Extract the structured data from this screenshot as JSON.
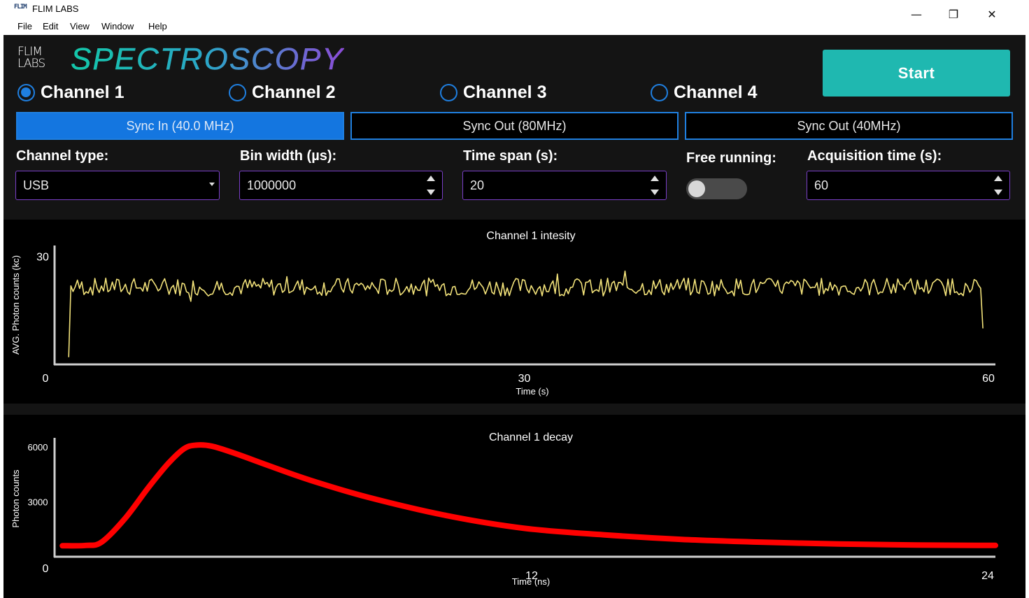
{
  "window": {
    "icon_text": "FLIM",
    "title": "FLIM LABS",
    "minimize": "—",
    "maximize": "❐",
    "close": "✕"
  },
  "menu": [
    "File",
    "Edit",
    "View",
    "Window",
    "Help"
  ],
  "header": {
    "logo_line1": "FLIM",
    "logo_line2": "LABS",
    "brand": "SPECTROSCOPY",
    "start_label": "Start",
    "start_color": "#1fb8b0"
  },
  "channels": [
    {
      "label": "Channel 1",
      "selected": true
    },
    {
      "label": "Channel 2",
      "selected": false
    },
    {
      "label": "Channel 3",
      "selected": false
    },
    {
      "label": "Channel 4",
      "selected": false
    }
  ],
  "sync": [
    {
      "label": "Sync In (40.0 MHz)",
      "active": true
    },
    {
      "label": "Sync Out (80MHz)",
      "active": false
    },
    {
      "label": "Sync Out (40MHz)",
      "active": false
    }
  ],
  "controls": {
    "channel_type_label": "Channel type:",
    "channel_type_value": "USB",
    "bin_width_label": "Bin width (µs):",
    "bin_width_value": "1000000",
    "time_span_label": "Time span (s):",
    "time_span_value": "20",
    "free_running_label": "Free running:",
    "free_running_on": false,
    "acq_time_label": "Acquisition time (s):",
    "acq_time_value": "60"
  },
  "accent_colors": {
    "blue": "#1f7fe0",
    "purple": "#7a3fc8",
    "yellow": "#f2e27a",
    "red": "#ff0000"
  },
  "chart_data": [
    {
      "type": "line",
      "title": "Channel 1 intesity",
      "xlabel": "Time (s)",
      "ylabel": "AVG. Photon counts (kc)",
      "xlim": [
        0,
        60
      ],
      "ylim": [
        0,
        33
      ],
      "x_ticks": [
        "0",
        "30",
        "60"
      ],
      "y_ticks": [
        "30"
      ],
      "series": [
        {
          "color": "#f2e27a",
          "description_values": {
            "start": 2,
            "plateau_mean": 21.5,
            "noise_amplitude": 2.5,
            "end": 10,
            "points": 420
          }
        }
      ]
    },
    {
      "type": "line",
      "title": "Channel 1 decay",
      "xlabel": "Time (ns)",
      "ylabel": "Photon counts",
      "xlim": [
        0,
        24
      ],
      "ylim": [
        0,
        6500
      ],
      "x_ticks": [
        "0",
        "12",
        "24"
      ],
      "y_ticks": [
        "6000",
        "3000"
      ],
      "series": [
        {
          "color": "#ff0000",
          "x": [
            0.2,
            0.8,
            1.2,
            1.8,
            2.4,
            2.9,
            3.3,
            3.6,
            4.0,
            4.6,
            5.5,
            6.5,
            8.0,
            10.0,
            12.0,
            14.0,
            16.0,
            18.0,
            20.0,
            22.0,
            24.0
          ],
          "y": [
            600,
            620,
            800,
            2100,
            3800,
            5100,
            5900,
            6100,
            6050,
            5650,
            4950,
            4200,
            3250,
            2250,
            1550,
            1200,
            950,
            800,
            700,
            640,
            620
          ]
        }
      ]
    }
  ]
}
